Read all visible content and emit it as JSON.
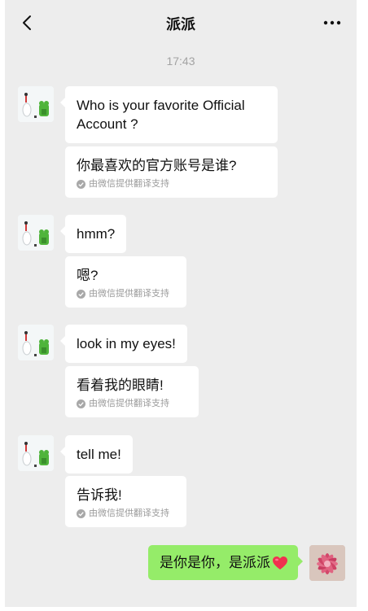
{
  "header": {
    "title": "派派",
    "back_icon": "chevron-left-icon",
    "more_icon": "more-dots-icon"
  },
  "time_label": "17:43",
  "translation_note": "由微信提供翻译支持",
  "messages": [
    {
      "original": "Who is your favorite Official Account ?",
      "translation": "你最喜欢的官方账号是谁?"
    },
    {
      "original": "hmm?",
      "translation": "嗯?"
    },
    {
      "original": "look in my eyes!",
      "translation": "看着我的眼睛!"
    },
    {
      "original": "tell me!",
      "translation": "告诉我!"
    }
  ],
  "my_message": {
    "text": "是你是你，是派派",
    "emoji": "heart-icon"
  },
  "colors": {
    "background": "#ededed",
    "my_bubble": "#95ec69",
    "other_bubble": "#ffffff",
    "heart": "#f0324f"
  }
}
